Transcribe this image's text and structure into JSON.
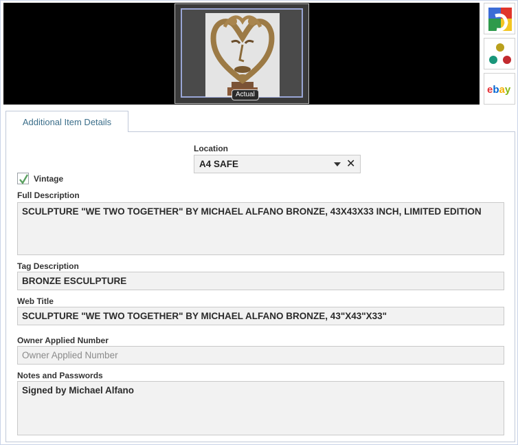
{
  "image_viewer": {
    "badge_label": "Actual"
  },
  "store_buttons": [
    {
      "icon": "google-icon"
    },
    {
      "icon": "dots-icon"
    },
    {
      "icon": "ebay-icon",
      "label": "ebay"
    }
  ],
  "tabs": [
    {
      "label": "Additional Item Details"
    }
  ],
  "location": {
    "label": "Location",
    "value": "A4 SAFE",
    "clear_glyph": "✕"
  },
  "vintage": {
    "label": "Vintage",
    "checked": true
  },
  "full_description": {
    "label": "Full Description",
    "value": "SCULPTURE \"WE TWO TOGETHER\" BY MICHAEL ALFANO BRONZE, 43X43X33 INCH, LIMITED EDITION"
  },
  "tag_description": {
    "label": "Tag Description",
    "value": "BRONZE ESCULPTURE"
  },
  "web_title": {
    "label": "Web Title",
    "value": "SCULPTURE \"WE TWO TOGETHER\" BY MICHAEL ALFANO BRONZE, 43\"X43\"X33\""
  },
  "owner_applied_number": {
    "label": "Owner Applied Number",
    "value": "",
    "placeholder": "Owner Applied Number"
  },
  "notes": {
    "label": "Notes and Passwords",
    "value": "Signed by Michael Alfano"
  },
  "colors": {
    "accent_tab_text": "#3b6e8a",
    "checkmark": "#5aa060",
    "field_bg": "#f2f2f2"
  }
}
